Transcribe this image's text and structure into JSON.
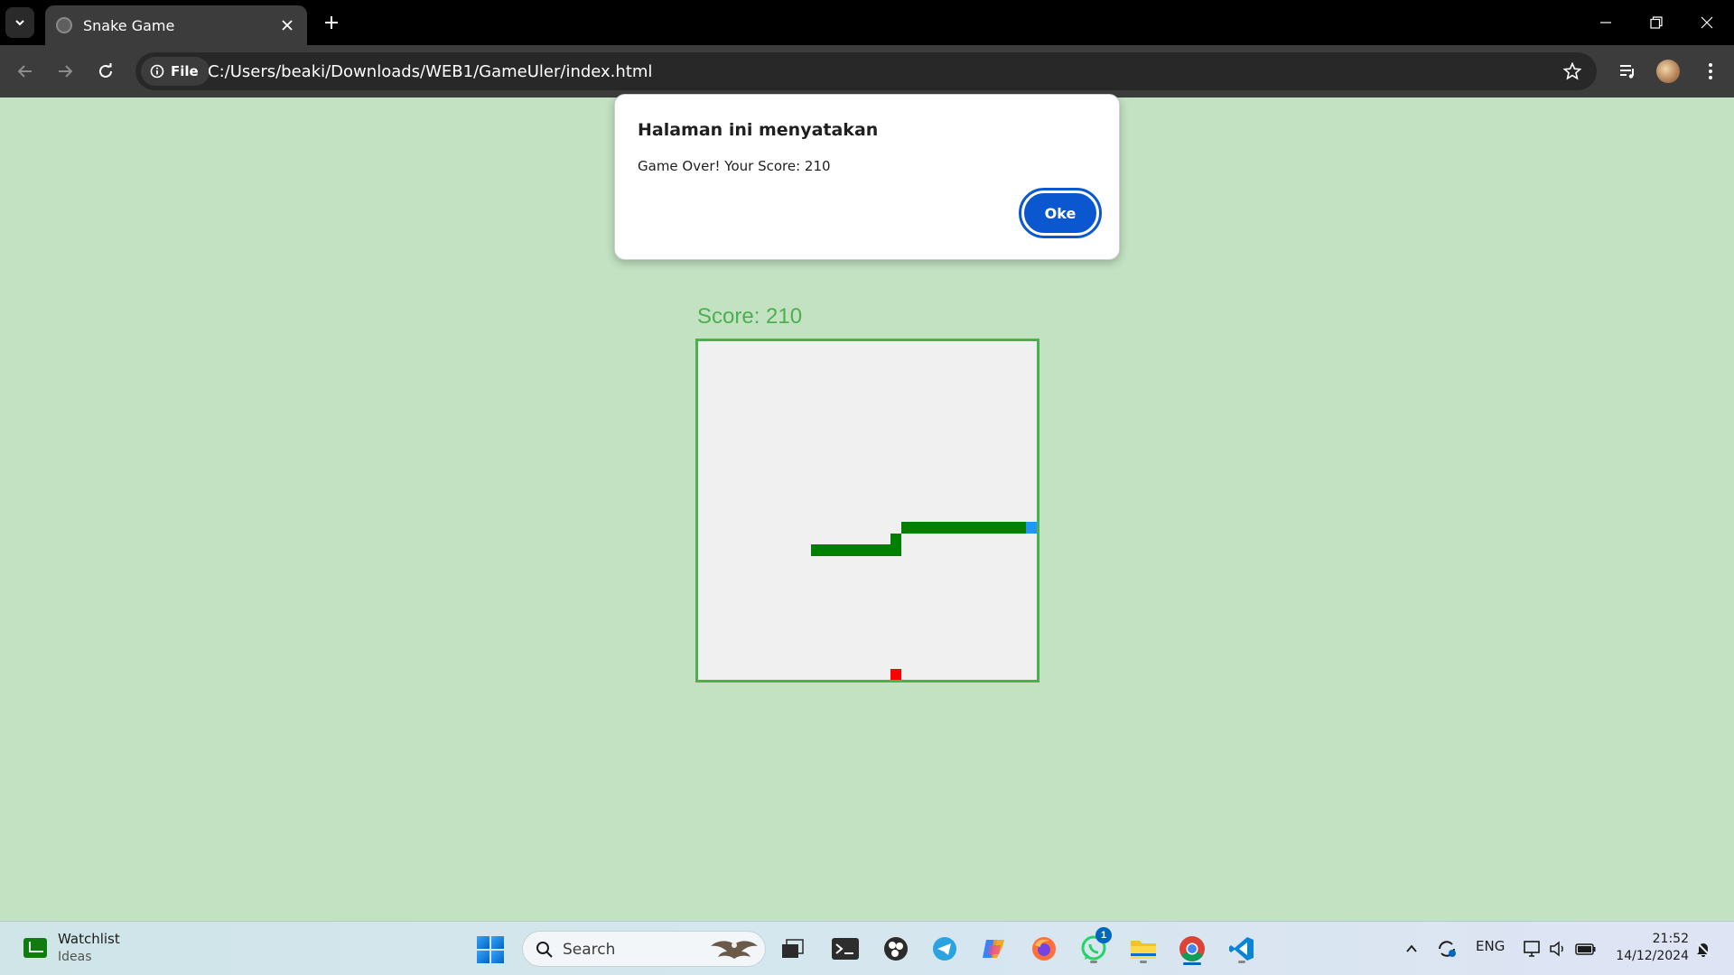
{
  "browser": {
    "tab_title": "Snake Game",
    "site_chip": "File",
    "url": "C:/Users/beaki/Downloads/WEB1/GameUler/index.html"
  },
  "dialog": {
    "title": "Halaman ini menyatakan",
    "message": "Game Over! Your Score: 210",
    "ok_label": "Oke"
  },
  "game": {
    "score_text": "Score: 210",
    "board_cells": 30,
    "snake_color": "#008000",
    "head_color": "#2196f3",
    "food_color": "#ff0000",
    "border_color": "#4caf50",
    "snake_cells": [
      [
        10,
        18
      ],
      [
        11,
        18
      ],
      [
        12,
        18
      ],
      [
        13,
        18
      ],
      [
        14,
        18
      ],
      [
        15,
        18
      ],
      [
        16,
        18
      ],
      [
        17,
        18
      ],
      [
        17,
        17
      ],
      [
        18,
        16
      ],
      [
        19,
        16
      ],
      [
        20,
        16
      ],
      [
        21,
        16
      ],
      [
        22,
        16
      ],
      [
        23,
        16
      ],
      [
        24,
        16
      ],
      [
        25,
        16
      ],
      [
        26,
        16
      ],
      [
        27,
        16
      ],
      [
        28,
        16
      ]
    ],
    "head_cell": [
      29,
      16
    ],
    "food_cell": [
      17,
      29
    ]
  },
  "taskbar": {
    "widget_title": "Watchlist",
    "widget_sub": "Ideas",
    "search_placeholder": "Search",
    "whatsapp_badge": "1",
    "language": "ENG",
    "time": "21:52",
    "date": "14/12/2024"
  },
  "colors": {
    "page_bg": "#c3e2c2",
    "dialog_button": "#0b57d0"
  }
}
